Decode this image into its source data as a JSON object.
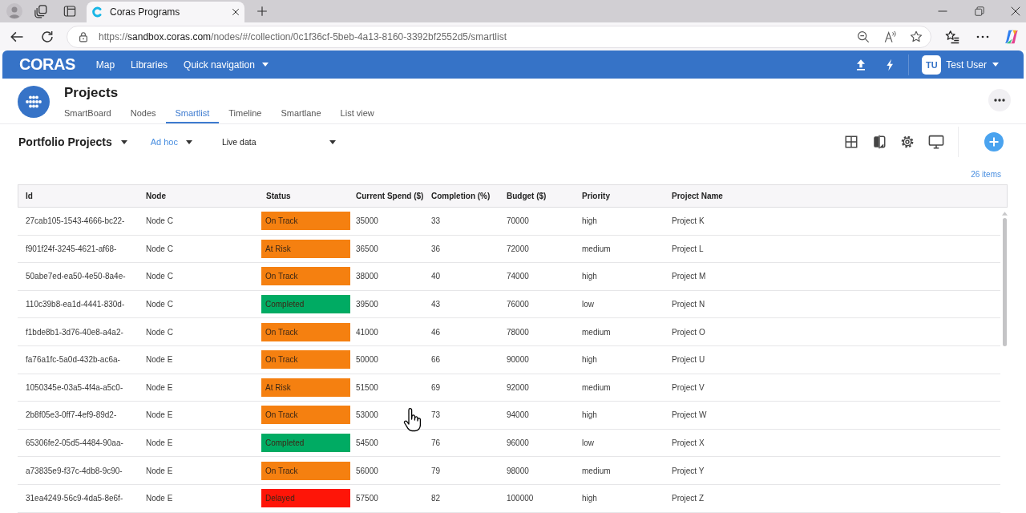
{
  "browser": {
    "tab": {
      "title": "Coras Programs"
    },
    "url": {
      "scheme": "https://",
      "host": "sandbox.coras.com",
      "path": "/nodes/#/collection/0c1f36cf-5beb-4a13-8160-3392bf2552d5/smartlist"
    }
  },
  "app_header": {
    "logo": "CORAS",
    "nav": [
      {
        "label": "Map",
        "has_menu": false
      },
      {
        "label": "Libraries",
        "has_menu": false
      },
      {
        "label": "Quick navigation",
        "has_menu": true
      }
    ],
    "user": {
      "initials": "TU",
      "name": "Test User"
    }
  },
  "page_header": {
    "title": "Projects",
    "tabs": [
      {
        "label": "SmartBoard",
        "selected": false
      },
      {
        "label": "Nodes",
        "selected": false
      },
      {
        "label": "Smartlist",
        "selected": true
      },
      {
        "label": "Timeline",
        "selected": false
      },
      {
        "label": "Smartlane",
        "selected": false
      },
      {
        "label": "List view",
        "selected": false
      }
    ]
  },
  "toolbar": {
    "view": "Portfolio Projects",
    "filter": "Ad hoc",
    "source": "Live data"
  },
  "item_count": "26 items",
  "table": {
    "columns": [
      "Id",
      "Node",
      "Status",
      "Current Spend ($)",
      "Completion (%)",
      "Budget ($)",
      "Priority",
      "Project Name"
    ],
    "rows": [
      {
        "id": "27cab105-1543-4666-bc22-",
        "node": "Node C",
        "status": {
          "label": "On Track",
          "color": "#f58010"
        },
        "current_spend": "35000",
        "completion": "33",
        "budget": "70000",
        "priority": "high",
        "project_name": "Project K"
      },
      {
        "id": "f901f24f-3245-4621-af68-",
        "node": "Node C",
        "status": {
          "label": "At Risk",
          "color": "#f58010"
        },
        "current_spend": "36500",
        "completion": "36",
        "budget": "72000",
        "priority": "medium",
        "project_name": "Project L"
      },
      {
        "id": "50abe7ed-ea50-4e50-8a4e-",
        "node": "Node C",
        "status": {
          "label": "On Track",
          "color": "#f58010"
        },
        "current_spend": "38000",
        "completion": "40",
        "budget": "74000",
        "priority": "high",
        "project_name": "Project M"
      },
      {
        "id": "110c39b8-ea1d-4441-830d-",
        "node": "Node C",
        "status": {
          "label": "Completed",
          "color": "#00ab63"
        },
        "current_spend": "39500",
        "completion": "43",
        "budget": "76000",
        "priority": "low",
        "project_name": "Project N"
      },
      {
        "id": "f1bde8b1-3d76-40e8-a4a2-",
        "node": "Node C",
        "status": {
          "label": "On Track",
          "color": "#f58010"
        },
        "current_spend": "41000",
        "completion": "46",
        "budget": "78000",
        "priority": "medium",
        "project_name": "Project O"
      },
      {
        "id": "fa76a1fc-5a0d-432b-ac6a-",
        "node": "Node E",
        "status": {
          "label": "On Track",
          "color": "#f58010"
        },
        "current_spend": "50000",
        "completion": "66",
        "budget": "90000",
        "priority": "high",
        "project_name": "Project U"
      },
      {
        "id": "1050345e-03a5-4f4a-a5c0-",
        "node": "Node E",
        "status": {
          "label": "At Risk",
          "color": "#f58010"
        },
        "current_spend": "51500",
        "completion": "69",
        "budget": "92000",
        "priority": "medium",
        "project_name": "Project V"
      },
      {
        "id": "2b8f05e3-0ff7-4ef9-89d2-",
        "node": "Node E",
        "status": {
          "label": "On Track",
          "color": "#f58010"
        },
        "current_spend": "53000",
        "completion": "73",
        "budget": "94000",
        "priority": "high",
        "project_name": "Project W"
      },
      {
        "id": "65306fe2-05d5-4484-90aa-",
        "node": "Node E",
        "status": {
          "label": "Completed",
          "color": "#00ab63"
        },
        "current_spend": "54500",
        "completion": "76",
        "budget": "96000",
        "priority": "low",
        "project_name": "Project X"
      },
      {
        "id": "a73835e9-f37c-4db8-9c90-",
        "node": "Node E",
        "status": {
          "label": "On Track",
          "color": "#f58010"
        },
        "current_spend": "56000",
        "completion": "79",
        "budget": "98000",
        "priority": "medium",
        "project_name": "Project Y"
      },
      {
        "id": "31ea4249-56c9-4da5-8e6f-",
        "node": "Node E",
        "status": {
          "label": "Delayed",
          "color": "#fe1508"
        },
        "current_spend": "57500",
        "completion": "82",
        "budget": "100000",
        "priority": "high",
        "project_name": "Project Z"
      }
    ]
  }
}
